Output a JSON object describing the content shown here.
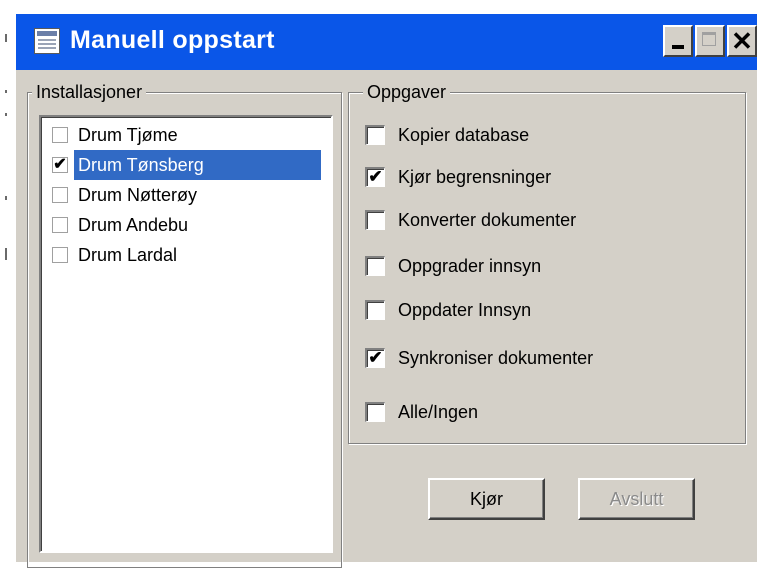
{
  "window": {
    "title": "Manuell oppstart",
    "controls": {
      "minimize": "minimize",
      "maximize": "maximize",
      "close": "✕"
    }
  },
  "installations": {
    "group_label": "Installasjoner",
    "items": [
      {
        "label": "Drum Tjøme",
        "checked": false,
        "selected": false
      },
      {
        "label": "Drum Tønsberg",
        "checked": true,
        "selected": true
      },
      {
        "label": "Drum Nøtterøy",
        "checked": false,
        "selected": false
      },
      {
        "label": "Drum Andebu",
        "checked": false,
        "selected": false
      },
      {
        "label": "Drum Lardal",
        "checked": false,
        "selected": false
      }
    ]
  },
  "tasks": {
    "group_label": "Oppgaver",
    "items": [
      {
        "label": "Kopier database",
        "checked": false
      },
      {
        "label": "Kjør begrensninger",
        "checked": true
      },
      {
        "label": "Konverter dokumenter",
        "checked": false
      },
      {
        "label": "Oppgrader innsyn",
        "checked": false
      },
      {
        "label": "Oppdater Innsyn",
        "checked": false
      },
      {
        "label": "Synkroniser dokumenter",
        "checked": true
      },
      {
        "label": "Alle/Ingen",
        "checked": false
      }
    ]
  },
  "buttons": {
    "run": {
      "label": "Kjør",
      "enabled": true
    },
    "exit": {
      "label": "Avslutt",
      "enabled": false
    }
  },
  "colors": {
    "titlebar": "#0a56e8",
    "selection": "#316ac5",
    "face": "#d4d0c8"
  },
  "icons": {
    "window_icon": "app-window-icon",
    "check": "✔"
  }
}
